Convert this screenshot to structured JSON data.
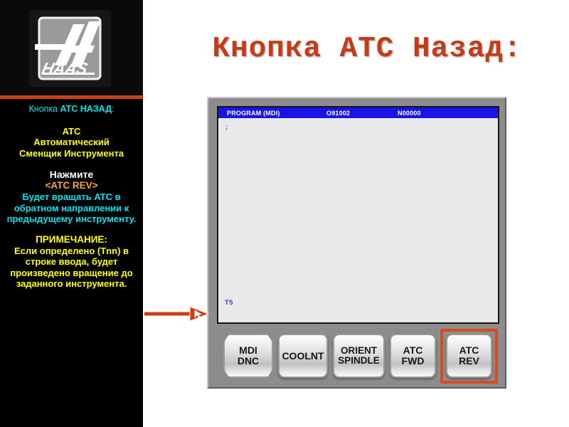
{
  "slide": {
    "title": "Кнопка ATC Назад:",
    "accent_color": "#c43b17",
    "divider_color": "#cc3f14",
    "background_color": "#ffffff"
  },
  "sidebar": {
    "background_color": "#000000",
    "logo": {
      "name": "haas-logo",
      "wordmark": "HAAS"
    },
    "heading": {
      "prefix": "Кнопка ",
      "strong": "ATC НАЗАД",
      "suffix": ":",
      "color": "#00e5ee"
    },
    "atc_abbr": "ATC",
    "atc_expansion_line1": "Автоматический",
    "atc_expansion_line2": "Сменщик Инструмента",
    "press_label": "Нажмите",
    "key_label": "<ATC REV>",
    "description": "Будет вращать ATC в обратном направлении к предыдущему инструменту.",
    "note_heading": "ПРИМЕЧАНИЕ:",
    "note_body": "Если определено (Tnn) в строке ввода, будет произведено вращение до заданного инструмента."
  },
  "cnc": {
    "screen": {
      "header": {
        "mode": "PROGRAM  (MDI)",
        "program_number": "O91002",
        "sequence_number": "N00000",
        "background_color": "#1a13e8",
        "text_color": "#ffffff"
      },
      "body": {
        "first_line": ";",
        "tool_label": "T5",
        "background_color": "#e9e9e9",
        "text_color": "#3c3ccc"
      }
    },
    "buttons": [
      {
        "id": "mdi-dnc",
        "line1": "MDI",
        "line2": "DNC",
        "highlighted": false
      },
      {
        "id": "coolnt",
        "line1": "COOLNT",
        "line2": "",
        "highlighted": false
      },
      {
        "id": "orient-spindle",
        "line1": "ORIENT",
        "line2": "SPINDLE",
        "highlighted": false
      },
      {
        "id": "atc-fwd",
        "line1": "ATC",
        "line2": "FWD",
        "highlighted": false
      },
      {
        "id": "atc-rev",
        "line1": "ATC",
        "line2": "REV",
        "highlighted": true
      }
    ],
    "highlight_color": "#d94b1a"
  },
  "pointer": {
    "name": "callout-arrow",
    "color": "#cc3f14",
    "direction": "right"
  }
}
